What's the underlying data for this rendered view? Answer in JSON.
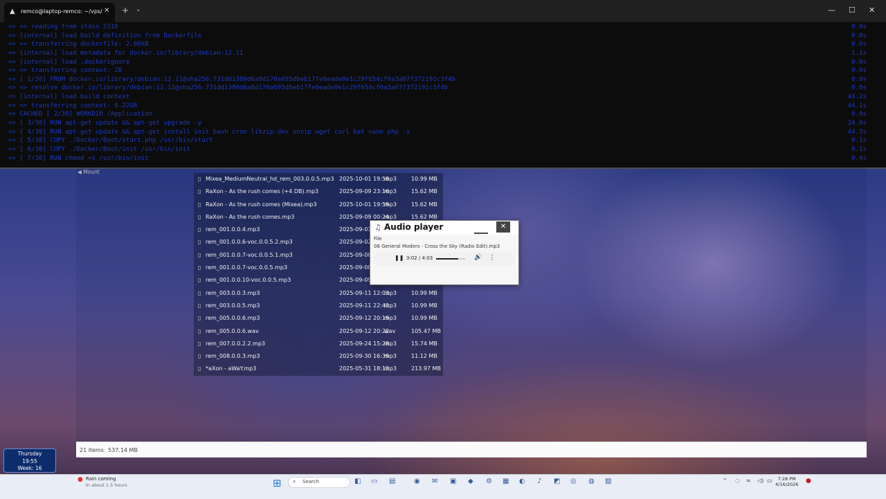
{
  "terminal": {
    "tab_title": "remco@laptop-remco: ~/vps/",
    "lines": [
      {
        "text": "=> => reading from stdin 5318",
        "time": "0.0s"
      },
      {
        "text": "=> [internal] load build definition from Dockerfile",
        "time": "0.0s"
      },
      {
        "text": "=> => transferring dockerfile: 2.06kB",
        "time": "0.0s"
      },
      {
        "text": "=> [internal] load metadata for docker.io/library/debian:12.11",
        "time": "1.1s"
      },
      {
        "text": "=> [internal] load .dockerignore",
        "time": "0.0s"
      },
      {
        "text": "=> => transferring context: 2B",
        "time": "0.0s"
      },
      {
        "text": "=> [ 1/30] FROM docker.io/library/debian:12.11@sha256:731dd1380d6a8d170a695dbeb17fe0eade0e1c29f654cf0a3a07f372191c3f4b",
        "time": "0.0s"
      },
      {
        "text": "=> => resolve docker.io/library/debian:12.11@sha256:731dd1380d6a8d170a695dbeb17fe0eade0e1c29f654cf0a3a07f372191c3f4b",
        "time": "0.0s"
      },
      {
        "text": "=> [internal] load build context",
        "time": "44.2s"
      },
      {
        "text": "=> => transferring context: 6.22GB",
        "time": "44.1s"
      },
      {
        "text": "=> CACHED [ 2/30] WORKDIR /Application",
        "time": "0.0s"
      },
      {
        "text": "=> [ 3/30] RUN apt-get update && apt-get upgrade -y",
        "time": "24.6s"
      },
      {
        "text": "=> [ 4/30] RUN apt-get update && apt-get install init bash cron libzip-dev unzip wget curl bat nano php -y",
        "time": "44.5s"
      },
      {
        "text": "=> [ 5/30] COPY ./Docker/Boot/start.php /usr/bin/start",
        "time": "0.1s"
      },
      {
        "text": "=> [ 6/30] COPY ./Docker/Boot/init /usr/bin/init",
        "time": "0.1s"
      },
      {
        "text": "=> [ 7/30] RUN chmod +x /usr/bin/init",
        "time": "0.4s"
      }
    ]
  },
  "file_manager": {
    "breadcrumb": "Mount",
    "files": [
      {
        "name": "Mixea_MediumNeutral_hd_rem_003.0.0.5.mp3",
        "date": "2025-10-01 19:58",
        "type": "mp3",
        "size": "10.99 MB"
      },
      {
        "name": "RaXon - As the rush comes (+4 DB).mp3",
        "date": "2025-09-09 23:16",
        "type": "mp3",
        "size": "15.62 MB"
      },
      {
        "name": "RaXon - As the rush comes (Mixea).mp3",
        "date": "2025-10-01 19:59",
        "type": "mp3",
        "size": "15.62 MB"
      },
      {
        "name": "RaXon - As the rush comes.mp3",
        "date": "2025-09-09 00:24",
        "type": "mp3",
        "size": "15.62 MB"
      },
      {
        "name": "rem_001.0.0.4.mp3",
        "date": "2025-09-01",
        "type": "",
        "size": ""
      },
      {
        "name": "rem_001.0.0.6-voc.0.0.5.2.mp3",
        "date": "2025-09-02",
        "type": "",
        "size": ""
      },
      {
        "name": "rem_001.0.0.7-voc.0.0.5.1.mp3",
        "date": "2025-09-08",
        "type": "",
        "size": ""
      },
      {
        "name": "rem_001.0.0.7-voc.0.0.5.mp3",
        "date": "2025-09-08",
        "type": "",
        "size": ""
      },
      {
        "name": "rem_001.0.0.10-voc.0.0.5.mp3",
        "date": "2025-09-09",
        "type": "mp3",
        "size": ""
      },
      {
        "name": "rem_003.0.0.3.mp3",
        "date": "2025-09-11 12:03",
        "type": "mp3",
        "size": "10.99 MB"
      },
      {
        "name": "rem_003.0.0.5.mp3",
        "date": "2025-09-11 22:42",
        "type": "mp3",
        "size": "10.99 MB"
      },
      {
        "name": "rem_005.0.0.6.mp3",
        "date": "2025-09-12 20:19",
        "type": "mp3",
        "size": "10.99 MB"
      },
      {
        "name": "rem_005.0.0.6.wav",
        "date": "2025-09-12 20:22",
        "type": "wav",
        "size": "105.47 MB"
      },
      {
        "name": "rem_007.0.0.2.2.mp3",
        "date": "2025-09-24 15:28",
        "type": "mp3",
        "size": "15.74 MB"
      },
      {
        "name": "rem_008.0.0.3.mp3",
        "date": "2025-09-30 16:39",
        "type": "mp3",
        "size": "11.12 MB"
      },
      {
        "name": "*aXon - aWaY.mp3",
        "date": "2025-05-31 18:12",
        "type": "mp3",
        "size": "213.97 MB"
      }
    ],
    "status": {
      "items": "21 items",
      "total": "537.14 MB"
    }
  },
  "audio_player": {
    "title": "Audio player",
    "menu": "File",
    "track": "08 General Moders - Cross the Sky (Radio Edit).mp3",
    "time": "3:02 / 4:03",
    "progress": 0.75
  },
  "clock_widget": {
    "day": "Thursday",
    "time": "19:55",
    "week": "Week: 16"
  },
  "taskbar": {
    "weather_title": "Rain coming",
    "weather_sub": "In about 1.5 hours",
    "search_placeholder": "Search",
    "clock_time": "7:28 PM",
    "clock_date": "4/16/2026"
  }
}
